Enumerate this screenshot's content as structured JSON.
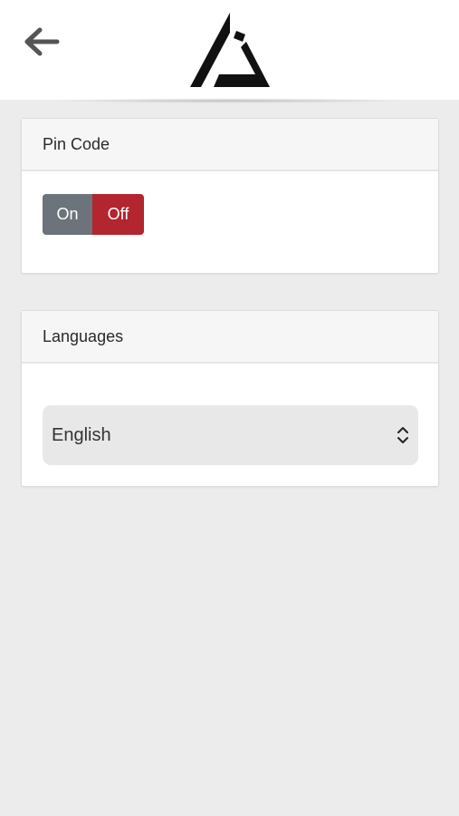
{
  "header": {
    "back_icon": "arrow-left-icon",
    "logo": "triangle-logo"
  },
  "pin_code": {
    "title": "Pin Code",
    "toggle": {
      "on_label": "On",
      "off_label": "Off",
      "selected": "Off",
      "on_color": "#6c737a",
      "off_color": "#b3252f"
    }
  },
  "languages": {
    "title": "Languages",
    "select": {
      "value": "English",
      "icon": "chevron-up-down-icon"
    }
  }
}
